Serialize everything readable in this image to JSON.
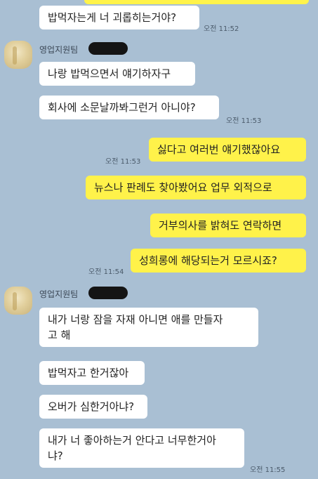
{
  "colors": {
    "background": "#a9bfd3",
    "incoming_bubble": "#ffffff",
    "outgoing_bubble": "#fff24a"
  },
  "messages": {
    "m1": {
      "text": "밥먹자는게 너 괴롭히는거야?",
      "time": "오전 11:52"
    },
    "sender1": "영업지원팀",
    "m2": {
      "text": "나랑 밥먹으면서 얘기하자구"
    },
    "m3": {
      "text": "회사에 소문날까봐그런거 아니야?",
      "time": "오전 11:53"
    },
    "m4": {
      "text": "싫다고 여러번 얘기했잖아요",
      "time": "오전 11:53"
    },
    "m5": {
      "text": "뉴스나 판례도 찾아봤어요 업무 외적으로"
    },
    "m6": {
      "text": "거부의사를 밝혀도 연락하면"
    },
    "m7": {
      "text": "성희롱에 해당되는거 모르시죠?",
      "time": "오전 11:54"
    },
    "sender2": "영업지원팀",
    "m8": {
      "text": "내가 너랑 잠을 자재 아니면 애를 만들자\n고 해"
    },
    "m9": {
      "text": "밥먹자고 한거잖아"
    },
    "m10": {
      "text": "오버가 심한거아냐?"
    },
    "m11": {
      "text": "내가 너 좋아하는거 안다고 너무한거아\n냐?",
      "time": "오전 11:55"
    }
  }
}
